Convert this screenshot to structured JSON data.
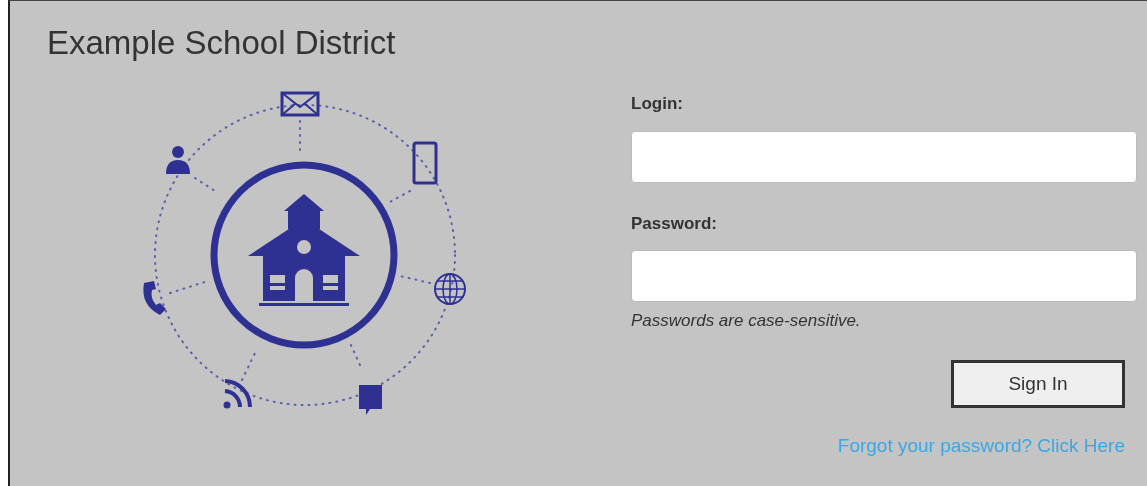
{
  "header": {
    "title": "Example School District"
  },
  "fields": [
    {
      "label": "Login:"
    },
    {
      "label": "Password:"
    }
  ],
  "hint": "Passwords are case-sensitive.",
  "sign_in_button": "Sign In",
  "forgot_link": "Forgot your password? Click Here"
}
